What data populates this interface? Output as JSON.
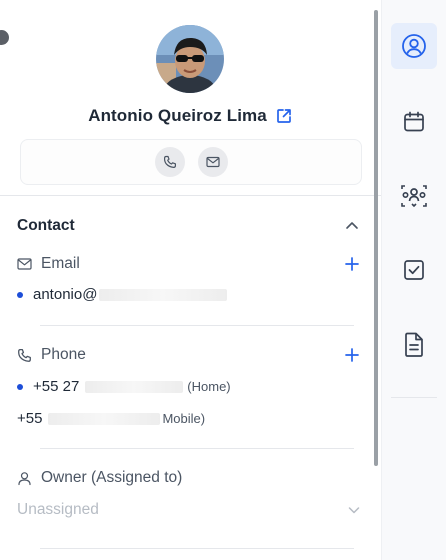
{
  "contact": {
    "name": "Antonio Queiroz Lima"
  },
  "sections": {
    "contact_title": "Contact"
  },
  "email": {
    "label": "Email",
    "value": "antonio@"
  },
  "phone": {
    "label": "Phone",
    "primary_prefix": "+55 27",
    "primary_tag": "(Home)",
    "secondary_prefix": "+55",
    "secondary_tag": "Mobile)"
  },
  "owner": {
    "label": "Owner (Assigned to)",
    "value": "Unassigned"
  },
  "icons": {
    "profile": "external-link-icon",
    "quick_actions": [
      "phone-icon",
      "mail-icon"
    ],
    "rail": [
      "user-circle-icon",
      "calendar-icon",
      "team-icon",
      "checkbox-icon",
      "document-icon"
    ]
  },
  "colors": {
    "accent": "#1d4ed8",
    "muted": "#b6bcc4",
    "rail_active_bg": "#e6eefc"
  }
}
